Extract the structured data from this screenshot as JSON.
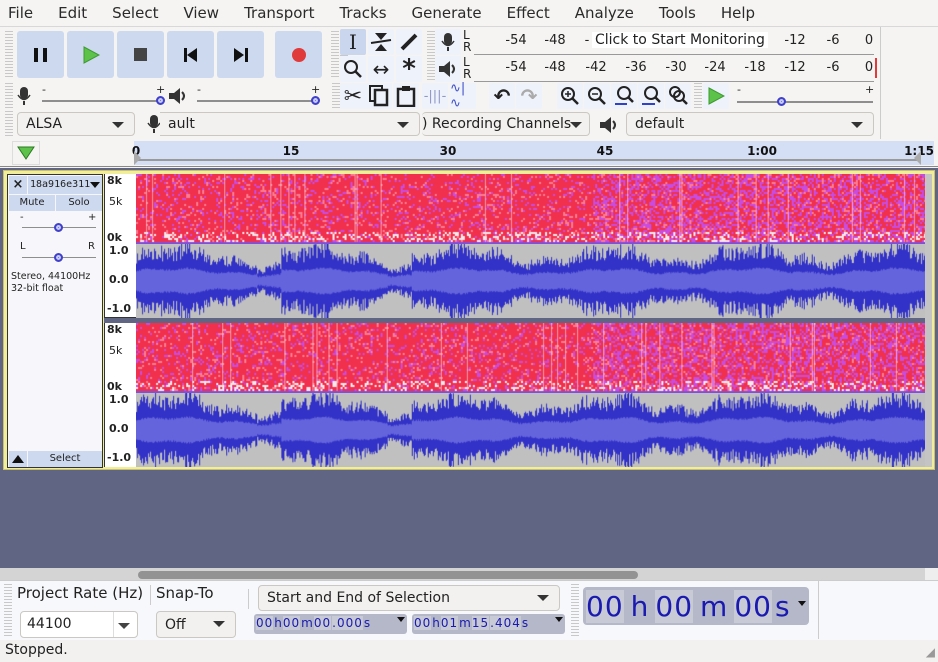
{
  "menu": [
    "File",
    "Edit",
    "Select",
    "View",
    "Transport",
    "Tracks",
    "Generate",
    "Effect",
    "Analyze",
    "Tools",
    "Help"
  ],
  "transport": {
    "buttons": [
      {
        "name": "pause-button",
        "icon": "pause-icon"
      },
      {
        "name": "play-button",
        "icon": "play-icon"
      },
      {
        "name": "stop-button",
        "icon": "stop-icon"
      },
      {
        "name": "skip-to-start-button",
        "icon": "skip-start-icon"
      },
      {
        "name": "skip-to-end-button",
        "icon": "skip-end-icon"
      },
      {
        "name": "record-button",
        "icon": "record-icon"
      }
    ],
    "colors": {
      "play": "#5cc24a",
      "record": "#e03a3a",
      "button_bg": "#cdd9ef"
    }
  },
  "tools": [
    "selection-tool",
    "envelope-tool",
    "draw-tool",
    "zoom-tool",
    "time-shift-tool",
    "multi-tool"
  ],
  "meters": {
    "record": {
      "channels": "L R",
      "ticks": [
        "-54",
        "-48",
        "-"
      ],
      "tail_ticks": [
        "-12",
        "-6",
        "0"
      ],
      "prompt": "Click to Start Monitoring"
    },
    "playback": {
      "channels": "L R",
      "ticks": [
        "-54",
        "-48",
        "-42",
        "-36",
        "-30",
        "-24",
        "-18",
        "-12",
        "-6",
        "0"
      ]
    }
  },
  "mixer": {
    "record_volume_pct": 100,
    "playback_volume_pct": 100,
    "minus": "-",
    "plus": "+"
  },
  "edit_toolbar": [
    "cut",
    "copy",
    "paste",
    "trim-audio",
    "silence-audio",
    "undo",
    "redo",
    "zoom-in",
    "zoom-out",
    "fit-selection",
    "fit-project",
    "zoom-toggle"
  ],
  "play_at_speed": {
    "speed_pct": 35,
    "minus": "-",
    "plus": "+"
  },
  "devices": {
    "host": "ALSA",
    "recording_device": "ault",
    "recording_channels": ") Recording Channels",
    "playback_device": "default"
  },
  "ruler": {
    "labels": [
      "0",
      "15",
      "30",
      "45",
      "1:00",
      "1:15"
    ],
    "values_sec": [
      0,
      15,
      30,
      45,
      60,
      75
    ]
  },
  "track": {
    "name": "18a916e311",
    "close": "×",
    "mute": "Mute",
    "solo": "Solo",
    "gain_minus": "-",
    "gain_plus": "+",
    "pan_left": "L",
    "pan_right": "R",
    "info_line1": "Stereo, 44100Hz",
    "info_line2": "32-bit float",
    "select": "Select",
    "spectro_scale": [
      "8k",
      "5k",
      "0k"
    ],
    "wave_scale": [
      "1.0",
      "0.0",
      "-1.0"
    ],
    "gain_pos": 0.5,
    "pan_pos": 0.5,
    "colors": {
      "wave_dark": "#3232c8",
      "wave_light": "#6464dc",
      "wave_bg": "#c0c0c0",
      "spectro": "#f0304c"
    }
  },
  "bottom": {
    "project_rate_label": "Project Rate (Hz)",
    "project_rate": "44100",
    "snap_label": "Snap-To",
    "snap": "Off",
    "selection_mode": "Start and End of Selection",
    "sel_start": [
      "00",
      "h",
      "00",
      "m",
      "00",
      ".000",
      "s"
    ],
    "sel_end": [
      "00",
      "h",
      "01",
      "m",
      "15",
      ".404",
      "s"
    ],
    "audio_pos": [
      "00",
      "h",
      "00",
      "m",
      "00",
      "s"
    ]
  },
  "status": "Stopped."
}
